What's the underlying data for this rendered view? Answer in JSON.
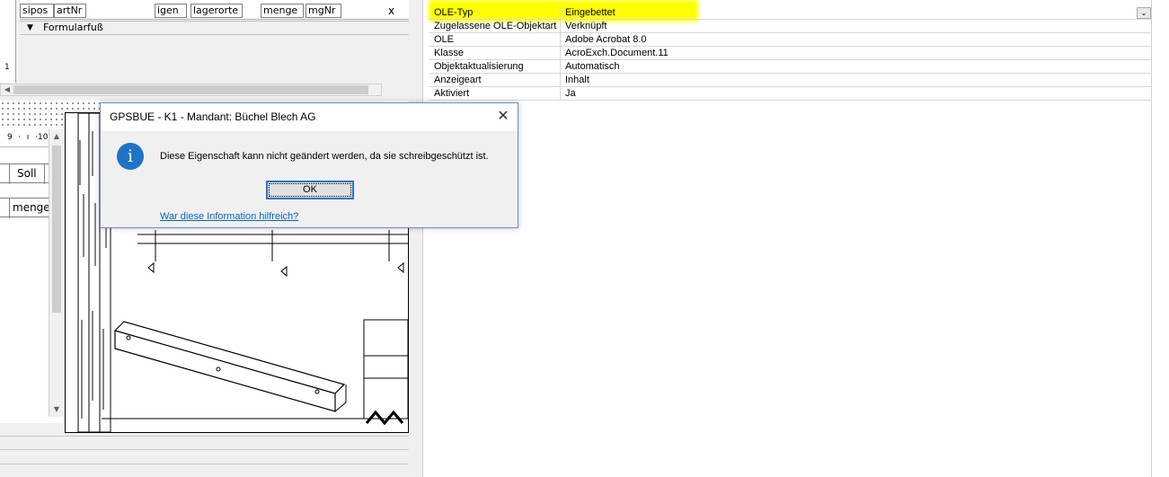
{
  "report": {
    "detail_fields": [
      "sipos",
      "artNr",
      "igen",
      "lagerorte",
      "menge",
      "mgNr"
    ],
    "footer_section_label": "Formularfuß",
    "ruler_numbers": [
      "1",
      "9",
      "10"
    ],
    "column_labels": [
      "Soll",
      "menge"
    ]
  },
  "properties": {
    "rows": [
      {
        "name": "OLE-Typ",
        "value": "Eingebettet"
      },
      {
        "name": "Zugelassene OLE-Objektart",
        "value": "Verknüpft"
      },
      {
        "name": "OLE",
        "value": "Adobe Acrobat 8.0"
      },
      {
        "name": "Klasse",
        "value": "AcroExch.Document.11"
      },
      {
        "name": "Objektaktualisierung",
        "value": "Automatisch"
      },
      {
        "name": "Anzeigeart",
        "value": "Inhalt"
      },
      {
        "name": "Aktiviert",
        "value": "Ja"
      }
    ],
    "highlight_color": "#ffff00"
  },
  "dialog": {
    "title": "GPSBUE - K1 - Mandant: Büchel Blech AG",
    "message": "Diese Eigenschaft kann nicht geändert werden, da sie schreibgeschützt ist.",
    "ok_label": "OK",
    "help_link": "War diese Information hilfreich?",
    "close_symbol": "✕",
    "icon_glyph": "i"
  }
}
